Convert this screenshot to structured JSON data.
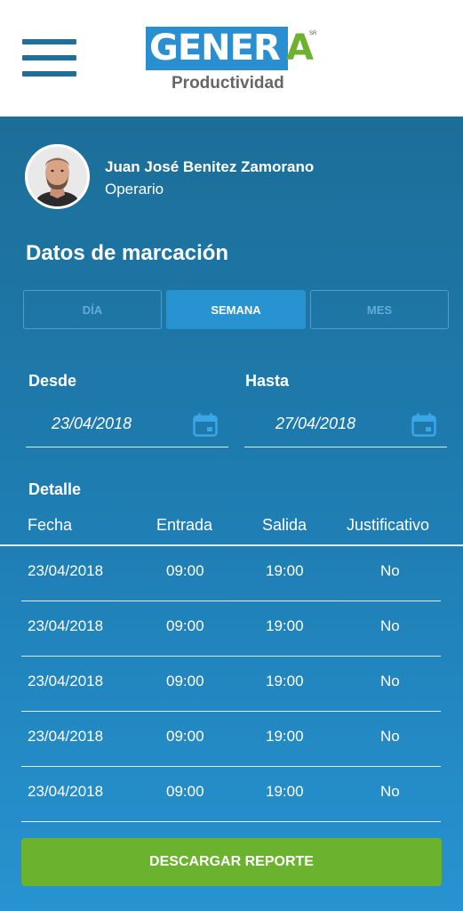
{
  "header": {
    "logo_text": "GENER",
    "logo_accent": "A",
    "logo_tm": "SR",
    "logo_subtitle": "Productividad",
    "menu_icon": "hamburger-menu-icon"
  },
  "user": {
    "name": "Juan José Benitez Zamorano",
    "role": "Operario"
  },
  "section_title": "Datos de marcación",
  "tabs": [
    {
      "label": "DÍA",
      "active": false
    },
    {
      "label": "SEMANA",
      "active": true
    },
    {
      "label": "MES",
      "active": false
    }
  ],
  "date_range": {
    "from_label": "Desde",
    "from_value": "23/04/2018",
    "to_label": "Hasta",
    "to_value": "27/04/2018",
    "icon": "calendar-icon"
  },
  "detail": {
    "title": "Detalle",
    "columns": [
      "Fecha",
      "Entrada",
      "Salida",
      "Justificativo"
    ],
    "rows": [
      [
        "23/04/2018",
        "09:00",
        "19:00",
        "No"
      ],
      [
        "23/04/2018",
        "09:00",
        "19:00",
        "No"
      ],
      [
        "23/04/2018",
        "09:00",
        "19:00",
        "No"
      ],
      [
        "23/04/2018",
        "09:00",
        "19:00",
        "No"
      ],
      [
        "23/04/2018",
        "09:00",
        "19:00",
        "No"
      ]
    ]
  },
  "download_button": "DESCARGAR REPORTE",
  "colors": {
    "brand_blue": "#2a8fd0",
    "brand_green": "#6db22e",
    "background_top": "#1c6e98",
    "background_bottom": "#2793d1",
    "button_green": "#6bb22e"
  }
}
